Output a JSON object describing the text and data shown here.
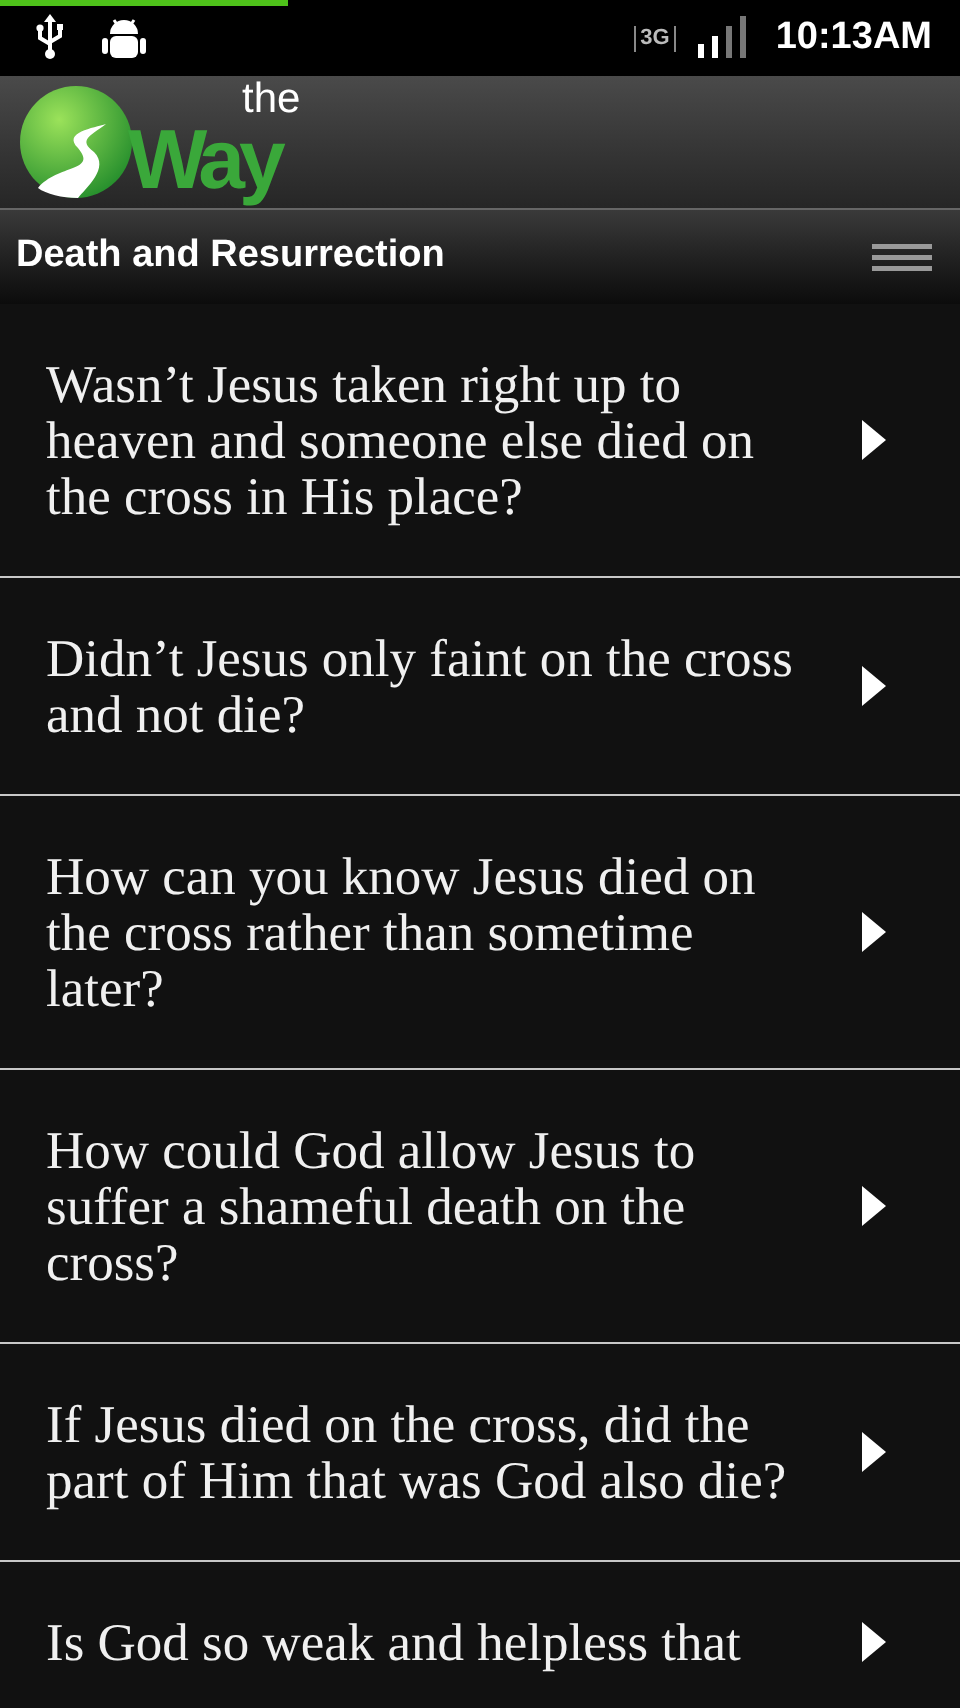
{
  "status_bar": {
    "loading": {
      "level": 0.3
    },
    "time": "10:13AM",
    "network": "3G"
  },
  "logo": {
    "small": "the",
    "large": "Way"
  },
  "header": {
    "title": "Death and Resurrection"
  },
  "questions": [
    {
      "text": "Wasn’t Jesus taken right up to heaven and someone else died on the cross in His place?"
    },
    {
      "text": "Didn’t Jesus only faint on the cross and not die?"
    },
    {
      "text": "How can you know Jesus died on the cross rather than sometime later?"
    },
    {
      "text": "How could God allow Jesus to suffer a shameful death on the cross?"
    },
    {
      "text": "If Jesus died on the cross, did the part of Him that was God also die?"
    },
    {
      "text": "Is God so weak and helpless that"
    }
  ]
}
